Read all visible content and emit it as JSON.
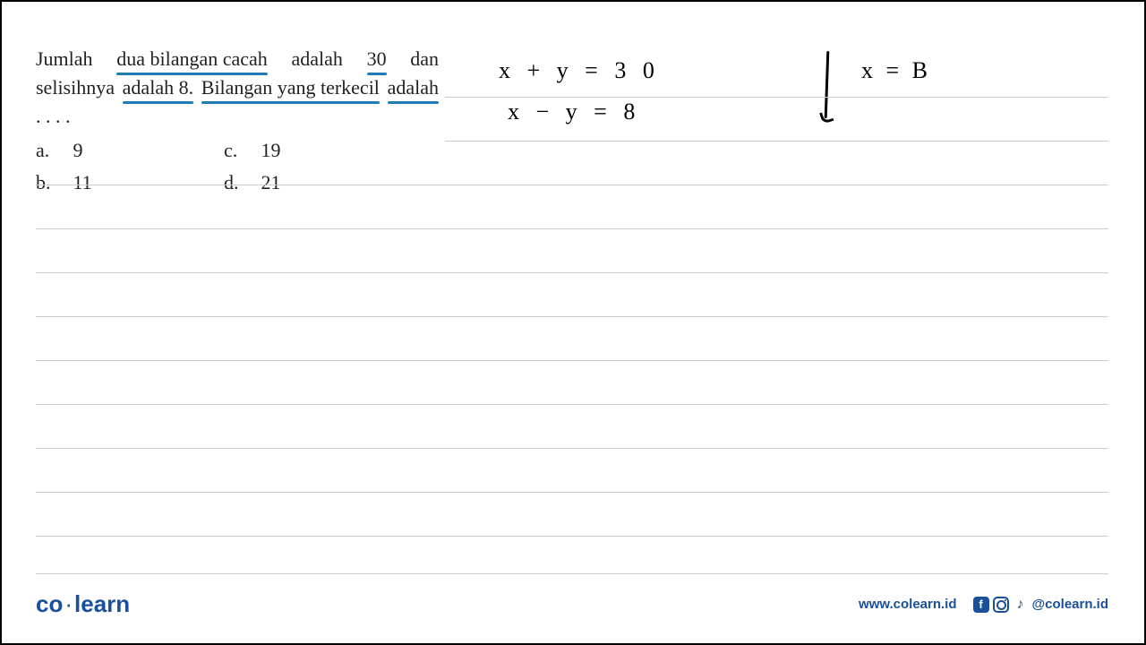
{
  "question": {
    "line1_pre": "Jumlah ",
    "line1_underlined": "dua bilangan cacah",
    "line1_mid": " adalah ",
    "line1_num": "30",
    "line1_post": " dan",
    "line2_pre": "selisihnya ",
    "line2_u1": "adalah 8.",
    "line2_mid": " ",
    "line2_u2": "Bilangan yang terkecil",
    "line3_pre": "",
    "line3_u": "adalah",
    "line3_post": " . . . ."
  },
  "options": {
    "a_label": "a.",
    "a_value": "9",
    "b_label": "b.",
    "b_value": "11",
    "c_label": "c.",
    "c_value": "19",
    "d_label": "d.",
    "d_value": "21"
  },
  "handwriting": {
    "eq1": "x + y = 3 0",
    "eq2": "x − y =  8",
    "eq3": "x = B"
  },
  "footer": {
    "logo_co": "co",
    "logo_learn": "learn",
    "website": "www.colearn.id",
    "handle": "@colearn.id"
  }
}
